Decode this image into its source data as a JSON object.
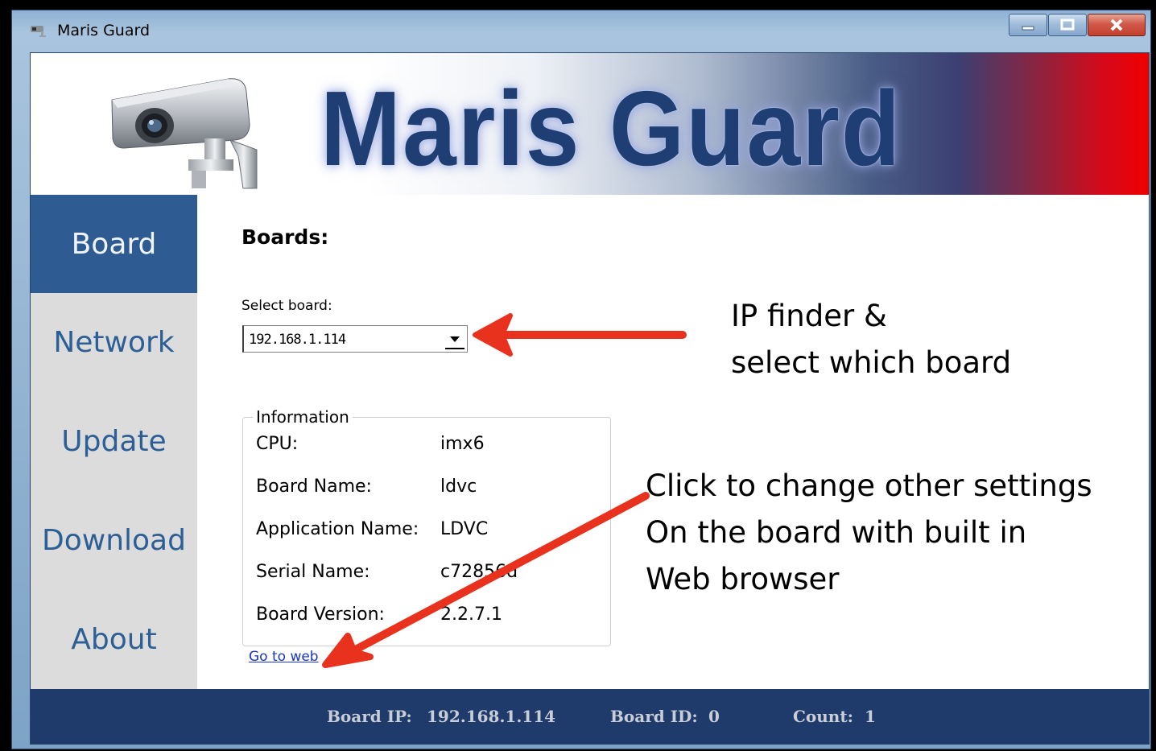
{
  "window": {
    "title": "Maris Guard"
  },
  "banner": {
    "brand": "Maris Guard"
  },
  "sidebar": {
    "items": [
      {
        "label": "Board",
        "active": true
      },
      {
        "label": "Network",
        "active": false
      },
      {
        "label": "Update",
        "active": false
      },
      {
        "label": "Download",
        "active": false
      },
      {
        "label": "About",
        "active": false
      }
    ]
  },
  "boards": {
    "heading": "Boards:",
    "select_label": "Select board:",
    "selected_board": "192.168.1.114"
  },
  "information": {
    "legend": "Information",
    "rows": [
      {
        "label": "CPU:",
        "value": "imx6"
      },
      {
        "label": "Board Name:",
        "value": "ldvc"
      },
      {
        "label": "Application Name:",
        "value": "LDVC"
      },
      {
        "label": "Serial Name:",
        "value": "c72856d"
      },
      {
        "label": "Board Version:",
        "value": "2.2.7.1"
      }
    ]
  },
  "link": {
    "go_to_web": "Go to web"
  },
  "status": {
    "board_ip_label": "Board IP:",
    "board_ip_value": "192.168.1.114",
    "board_id_label": "Board ID:",
    "board_id_value": "0",
    "count_label": "Count:",
    "count_value": "1"
  },
  "annotations": {
    "ip_finder_line1": "IP finder &",
    "ip_finder_line2": "select which board",
    "web_line1": "Click to change other settings",
    "web_line2": "On the board with built in",
    "web_line3": "Web browser"
  },
  "colors": {
    "accent": "#2e5b92",
    "status_bar": "#1e3b6b",
    "arrow": "#e8321e",
    "nav_text": "#2c5f95"
  }
}
